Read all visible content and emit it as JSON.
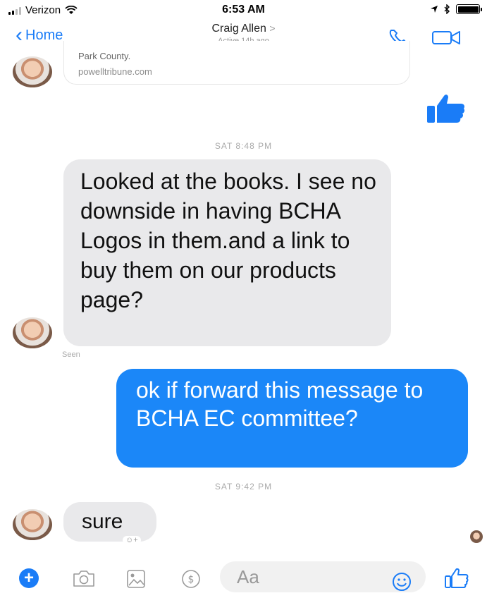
{
  "status_bar": {
    "carrier": "Verizon",
    "time": "6:53 AM"
  },
  "header": {
    "back_label": "Home",
    "contact_name": "Craig Allen",
    "contact_arrow": ">",
    "contact_status": "Active 14h ago"
  },
  "link_preview": {
    "title": "Park County.",
    "url": "powelltribune.com"
  },
  "timestamps": [
    "SAT 8:48 PM",
    "SAT 9:42 PM"
  ],
  "messages": [
    {
      "from": "Craig Allen",
      "text": "Looked at the books. I see no downside in having BCHA Logos in them.and a link to buy them on our products page?"
    },
    {
      "from": "me",
      "text": "ok if forward this message  to BCHA EC committee?"
    },
    {
      "from": "Craig Allen",
      "text": "sure"
    }
  ],
  "seen_label": "Seen",
  "composer": {
    "placeholder": "Aa"
  },
  "colors": {
    "accent": "#1a7cf7",
    "outgoing_bubble": "#1b87f8",
    "incoming_bubble": "#e9e9eb"
  }
}
